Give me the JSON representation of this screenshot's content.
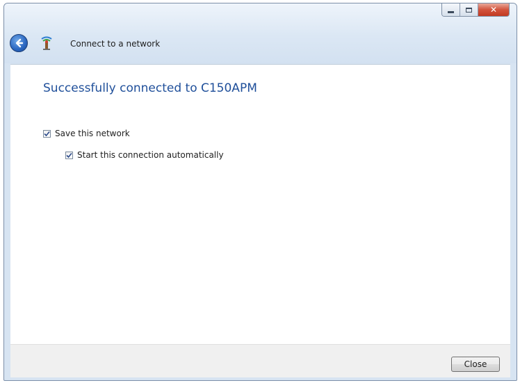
{
  "window": {
    "title": "Connect to a network"
  },
  "titlebar_buttons": {
    "minimize_icon": "minimize-icon",
    "maximize_icon": "maximize-icon",
    "close_icon": "close-icon"
  },
  "main": {
    "heading": "Successfully connected to C150APM",
    "options": [
      {
        "label": "Save this network",
        "checked": true
      },
      {
        "label": "Start this connection automatically",
        "checked": true
      }
    ]
  },
  "footer": {
    "close_label": "Close"
  },
  "colors": {
    "heading": "#1f4f9a",
    "chrome": "#d7e4f2",
    "close_button_red": "#c23a22"
  }
}
